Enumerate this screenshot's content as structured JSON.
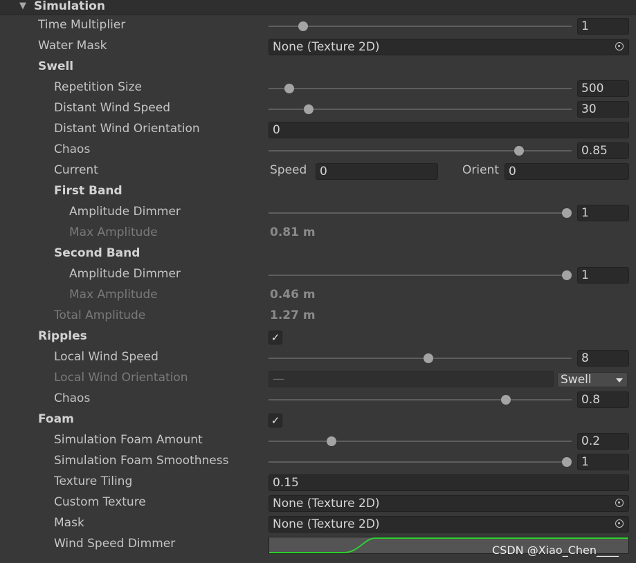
{
  "section": {
    "title": "Simulation",
    "expanded": true
  },
  "time_multiplier": {
    "label": "Time Multiplier",
    "value": "1",
    "slider_fraction": 0.115
  },
  "water_mask": {
    "label": "Water Mask",
    "value": "None (Texture 2D)"
  },
  "swell": {
    "heading": "Swell",
    "repetition_size": {
      "label": "Repetition Size",
      "value": "500",
      "slider_fraction": 0.07
    },
    "distant_wind_speed": {
      "label": "Distant Wind Speed",
      "value": "30",
      "slider_fraction": 0.135
    },
    "distant_wind_orientation": {
      "label": "Distant Wind Orientation",
      "value": "0"
    },
    "chaos": {
      "label": "Chaos",
      "value": "0.85",
      "slider_fraction": 0.84
    },
    "current": {
      "label": "Current",
      "speed_label": "Speed",
      "speed_value": "0",
      "orient_label": "Orient",
      "orient_value": "0"
    },
    "first_band": {
      "heading": "First Band",
      "amplitude_dimmer": {
        "label": "Amplitude Dimmer",
        "value": "1",
        "slider_fraction": 1.0
      },
      "max_amplitude": {
        "label": "Max Amplitude",
        "value": "0.81 m"
      }
    },
    "second_band": {
      "heading": "Second Band",
      "amplitude_dimmer": {
        "label": "Amplitude Dimmer",
        "value": "1",
        "slider_fraction": 1.0
      },
      "max_amplitude": {
        "label": "Max Amplitude",
        "value": "0.46 m"
      }
    },
    "total_amplitude": {
      "label": "Total Amplitude",
      "value": "1.27 m"
    }
  },
  "ripples": {
    "heading": "Ripples",
    "enabled": true,
    "check_glyph": "✓",
    "local_wind_speed": {
      "label": "Local Wind Speed",
      "value": "8",
      "slider_fraction": 0.535
    },
    "local_wind_orientation": {
      "label": "Local Wind Orientation",
      "value": "—",
      "mode": "Swell"
    },
    "chaos": {
      "label": "Chaos",
      "value": "0.8",
      "slider_fraction": 0.795
    }
  },
  "foam": {
    "heading": "Foam",
    "enabled": true,
    "check_glyph": "✓",
    "simulation_foam_amount": {
      "label": "Simulation Foam Amount",
      "value": "0.2",
      "slider_fraction": 0.21
    },
    "simulation_foam_smoothness": {
      "label": "Simulation Foam Smoothness",
      "value": "1",
      "slider_fraction": 1.0
    },
    "texture_tiling": {
      "label": "Texture Tiling",
      "value": "0.15"
    },
    "custom_texture": {
      "label": "Custom Texture",
      "value": "None (Texture 2D)"
    },
    "mask": {
      "label": "Mask",
      "value": "None (Texture 2D)"
    },
    "wind_speed_dimmer": {
      "label": "Wind Speed Dimmer"
    }
  },
  "watermark": "CSDN @Xiao_Chen____",
  "colors": {
    "background": "#383838",
    "field": "#2a2a2a",
    "curve_line": "#2fcf2f",
    "thumb": "#a4a4a4"
  }
}
